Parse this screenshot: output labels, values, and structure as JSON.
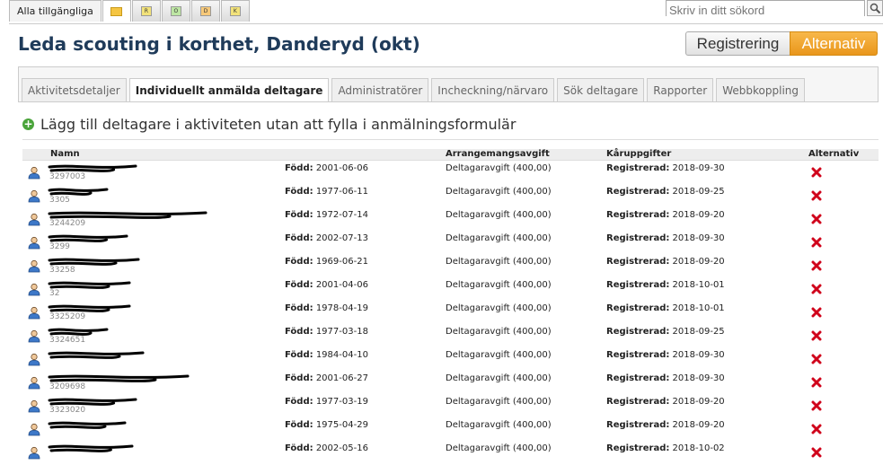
{
  "top_tabs": [
    {
      "label": "Alla tillgängliga"
    },
    {
      "icon": "folder-icon"
    },
    {
      "icon": "yellow-r-icon",
      "glyph": "R"
    },
    {
      "icon": "green-o-icon",
      "glyph": "O"
    },
    {
      "icon": "orange-d-icon",
      "glyph": "D"
    },
    {
      "icon": "yellow-k-icon",
      "glyph": "K"
    }
  ],
  "search": {
    "placeholder": "Skriv in ditt sökord"
  },
  "page_title": "Leda scouting i korthet, Danderyd (okt)",
  "buttons": {
    "registrering": "Registrering",
    "alternativ": "Alternativ"
  },
  "subtabs": [
    {
      "label": "Aktivitetsdetaljer",
      "active": false
    },
    {
      "label": "Individuellt anmälda deltagare",
      "active": true
    },
    {
      "label": "Administratörer",
      "active": false
    },
    {
      "label": "Incheckning/närvaro",
      "active": false
    },
    {
      "label": "Sök deltagare",
      "active": false
    },
    {
      "label": "Rapporter",
      "active": false
    },
    {
      "label": "Webbkoppling",
      "active": false
    }
  ],
  "add_participant": "Lägg till deltagare i aktiviteten utan att fylla i anmälningsformulär",
  "table": {
    "headers": {
      "name": "Namn",
      "fee": "Arrangemangsavgift",
      "group": "Kåruppgifter",
      "options": "Alternativ"
    },
    "born_label": "Född:",
    "registered_label": "Registrerad:",
    "rows": [
      {
        "name": "",
        "number": "3297003",
        "born": "2001-06-06",
        "fee": "Deltagaravgift (400,00)",
        "registered": "2018-09-30"
      },
      {
        "name": "",
        "number": "3305",
        "born": "1977-06-11",
        "fee": "Deltagaravgift (400,00)",
        "registered": "2018-09-25"
      },
      {
        "name": "",
        "number": "3244209",
        "born": "1972-07-14",
        "fee": "Deltagaravgift (400,00)",
        "registered": "2018-09-20"
      },
      {
        "name": "",
        "number": "3299",
        "born": "2002-07-13",
        "fee": "Deltagaravgift (400,00)",
        "registered": "2018-09-30"
      },
      {
        "name": "",
        "number": "33258",
        "born": "1969-06-21",
        "fee": "Deltagaravgift (400,00)",
        "registered": "2018-09-20"
      },
      {
        "name": "",
        "number": "32",
        "born": "2001-04-06",
        "fee": "Deltagaravgift (400,00)",
        "registered": "2018-10-01"
      },
      {
        "name": "",
        "number": "3325209",
        "born": "1978-04-19",
        "fee": "Deltagaravgift (400,00)",
        "registered": "2018-10-01"
      },
      {
        "name": "",
        "number": "3324651",
        "born": "1977-03-18",
        "fee": "Deltagaravgift (400,00)",
        "registered": "2018-09-25"
      },
      {
        "name": "",
        "number": "",
        "born": "1984-04-10",
        "fee": "Deltagaravgift (400,00)",
        "registered": "2018-09-30"
      },
      {
        "name": "",
        "number": "3209698",
        "born": "2001-06-27",
        "fee": "Deltagaravgift (400,00)",
        "registered": "2018-09-30"
      },
      {
        "name": "",
        "number": "3323020",
        "born": "1977-03-19",
        "fee": "Deltagaravgift (400,00)",
        "registered": "2018-09-20"
      },
      {
        "name": "",
        "number": "",
        "born": "1975-04-29",
        "fee": "Deltagaravgift (400,00)",
        "registered": "2018-09-20"
      },
      {
        "name": "",
        "number": "",
        "born": "2002-05-16",
        "fee": "Deltagaravgift (400,00)",
        "registered": "2018-10-02"
      }
    ]
  }
}
